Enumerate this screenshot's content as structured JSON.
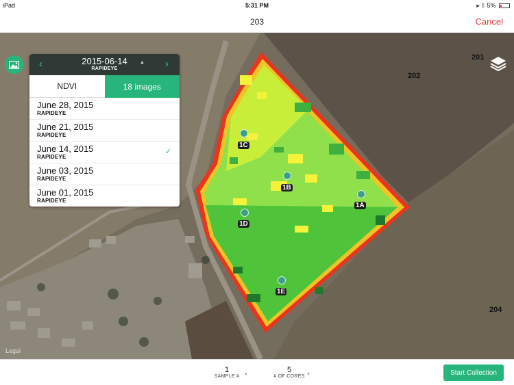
{
  "status_bar": {
    "device": "iPad",
    "time": "5:31 PM",
    "battery": "5%"
  },
  "nav": {
    "title": "203",
    "cancel_label": "Cancel"
  },
  "image_panel": {
    "date": "2015-06-14",
    "sensor": "RAPIDEYE",
    "tabs": {
      "ndvi": "NDVI",
      "images": "18 images"
    },
    "items": [
      {
        "date": "June 28, 2015",
        "sensor": "RAPIDEYE",
        "selected": false
      },
      {
        "date": "June 21, 2015",
        "sensor": "RAPIDEYE",
        "selected": false
      },
      {
        "date": "June 14, 2015",
        "sensor": "RAPIDEYE",
        "selected": true
      },
      {
        "date": "June 03, 2015",
        "sensor": "RAPIDEYE",
        "selected": false
      },
      {
        "date": "June 01, 2015",
        "sensor": "RAPIDEYE",
        "selected": false
      }
    ]
  },
  "map": {
    "field_labels": [
      "201",
      "202",
      "204"
    ],
    "sample_points": [
      "1C",
      "1B",
      "1A",
      "1D",
      "1E"
    ],
    "legal": "Legal"
  },
  "bottom": {
    "sample_value": "1",
    "sample_label": "SAMPLE #",
    "cores_value": "5",
    "cores_label": "# OF CORES",
    "start_label": "Start Collection"
  },
  "colors": {
    "accent": "#27b57c",
    "cancel": "#e23d3d",
    "panel_header": "#2f3a36"
  }
}
